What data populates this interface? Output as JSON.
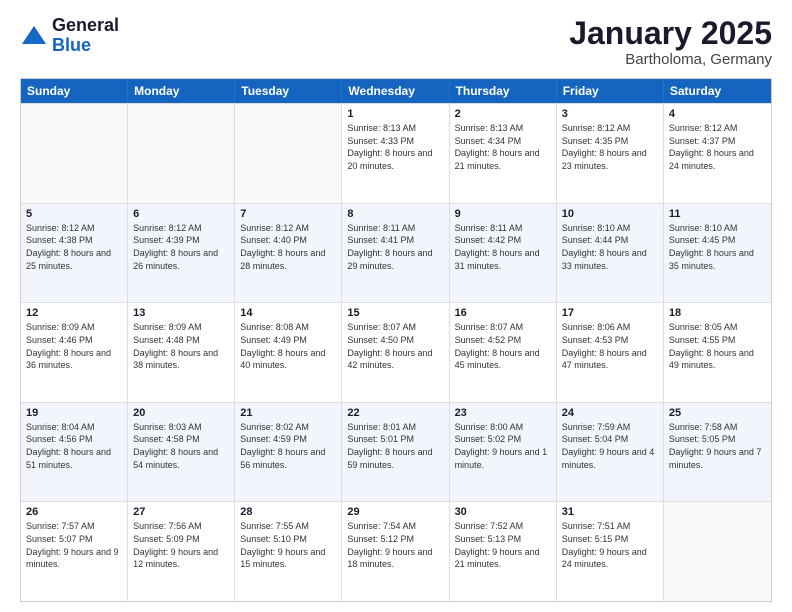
{
  "logo": {
    "general": "General",
    "blue": "Blue"
  },
  "header": {
    "month": "January 2025",
    "location": "Bartholoma, Germany"
  },
  "weekdays": [
    "Sunday",
    "Monday",
    "Tuesday",
    "Wednesday",
    "Thursday",
    "Friday",
    "Saturday"
  ],
  "weeks": [
    [
      {
        "day": "",
        "sunrise": "",
        "sunset": "",
        "daylight": ""
      },
      {
        "day": "",
        "sunrise": "",
        "sunset": "",
        "daylight": ""
      },
      {
        "day": "",
        "sunrise": "",
        "sunset": "",
        "daylight": ""
      },
      {
        "day": "1",
        "sunrise": "Sunrise: 8:13 AM",
        "sunset": "Sunset: 4:33 PM",
        "daylight": "Daylight: 8 hours and 20 minutes."
      },
      {
        "day": "2",
        "sunrise": "Sunrise: 8:13 AM",
        "sunset": "Sunset: 4:34 PM",
        "daylight": "Daylight: 8 hours and 21 minutes."
      },
      {
        "day": "3",
        "sunrise": "Sunrise: 8:12 AM",
        "sunset": "Sunset: 4:35 PM",
        "daylight": "Daylight: 8 hours and 23 minutes."
      },
      {
        "day": "4",
        "sunrise": "Sunrise: 8:12 AM",
        "sunset": "Sunset: 4:37 PM",
        "daylight": "Daylight: 8 hours and 24 minutes."
      }
    ],
    [
      {
        "day": "5",
        "sunrise": "Sunrise: 8:12 AM",
        "sunset": "Sunset: 4:38 PM",
        "daylight": "Daylight: 8 hours and 25 minutes."
      },
      {
        "day": "6",
        "sunrise": "Sunrise: 8:12 AM",
        "sunset": "Sunset: 4:39 PM",
        "daylight": "Daylight: 8 hours and 26 minutes."
      },
      {
        "day": "7",
        "sunrise": "Sunrise: 8:12 AM",
        "sunset": "Sunset: 4:40 PM",
        "daylight": "Daylight: 8 hours and 28 minutes."
      },
      {
        "day": "8",
        "sunrise": "Sunrise: 8:11 AM",
        "sunset": "Sunset: 4:41 PM",
        "daylight": "Daylight: 8 hours and 29 minutes."
      },
      {
        "day": "9",
        "sunrise": "Sunrise: 8:11 AM",
        "sunset": "Sunset: 4:42 PM",
        "daylight": "Daylight: 8 hours and 31 minutes."
      },
      {
        "day": "10",
        "sunrise": "Sunrise: 8:10 AM",
        "sunset": "Sunset: 4:44 PM",
        "daylight": "Daylight: 8 hours and 33 minutes."
      },
      {
        "day": "11",
        "sunrise": "Sunrise: 8:10 AM",
        "sunset": "Sunset: 4:45 PM",
        "daylight": "Daylight: 8 hours and 35 minutes."
      }
    ],
    [
      {
        "day": "12",
        "sunrise": "Sunrise: 8:09 AM",
        "sunset": "Sunset: 4:46 PM",
        "daylight": "Daylight: 8 hours and 36 minutes."
      },
      {
        "day": "13",
        "sunrise": "Sunrise: 8:09 AM",
        "sunset": "Sunset: 4:48 PM",
        "daylight": "Daylight: 8 hours and 38 minutes."
      },
      {
        "day": "14",
        "sunrise": "Sunrise: 8:08 AM",
        "sunset": "Sunset: 4:49 PM",
        "daylight": "Daylight: 8 hours and 40 minutes."
      },
      {
        "day": "15",
        "sunrise": "Sunrise: 8:07 AM",
        "sunset": "Sunset: 4:50 PM",
        "daylight": "Daylight: 8 hours and 42 minutes."
      },
      {
        "day": "16",
        "sunrise": "Sunrise: 8:07 AM",
        "sunset": "Sunset: 4:52 PM",
        "daylight": "Daylight: 8 hours and 45 minutes."
      },
      {
        "day": "17",
        "sunrise": "Sunrise: 8:06 AM",
        "sunset": "Sunset: 4:53 PM",
        "daylight": "Daylight: 8 hours and 47 minutes."
      },
      {
        "day": "18",
        "sunrise": "Sunrise: 8:05 AM",
        "sunset": "Sunset: 4:55 PM",
        "daylight": "Daylight: 8 hours and 49 minutes."
      }
    ],
    [
      {
        "day": "19",
        "sunrise": "Sunrise: 8:04 AM",
        "sunset": "Sunset: 4:56 PM",
        "daylight": "Daylight: 8 hours and 51 minutes."
      },
      {
        "day": "20",
        "sunrise": "Sunrise: 8:03 AM",
        "sunset": "Sunset: 4:58 PM",
        "daylight": "Daylight: 8 hours and 54 minutes."
      },
      {
        "day": "21",
        "sunrise": "Sunrise: 8:02 AM",
        "sunset": "Sunset: 4:59 PM",
        "daylight": "Daylight: 8 hours and 56 minutes."
      },
      {
        "day": "22",
        "sunrise": "Sunrise: 8:01 AM",
        "sunset": "Sunset: 5:01 PM",
        "daylight": "Daylight: 8 hours and 59 minutes."
      },
      {
        "day": "23",
        "sunrise": "Sunrise: 8:00 AM",
        "sunset": "Sunset: 5:02 PM",
        "daylight": "Daylight: 9 hours and 1 minute."
      },
      {
        "day": "24",
        "sunrise": "Sunrise: 7:59 AM",
        "sunset": "Sunset: 5:04 PM",
        "daylight": "Daylight: 9 hours and 4 minutes."
      },
      {
        "day": "25",
        "sunrise": "Sunrise: 7:58 AM",
        "sunset": "Sunset: 5:05 PM",
        "daylight": "Daylight: 9 hours and 7 minutes."
      }
    ],
    [
      {
        "day": "26",
        "sunrise": "Sunrise: 7:57 AM",
        "sunset": "Sunset: 5:07 PM",
        "daylight": "Daylight: 9 hours and 9 minutes."
      },
      {
        "day": "27",
        "sunrise": "Sunrise: 7:56 AM",
        "sunset": "Sunset: 5:09 PM",
        "daylight": "Daylight: 9 hours and 12 minutes."
      },
      {
        "day": "28",
        "sunrise": "Sunrise: 7:55 AM",
        "sunset": "Sunset: 5:10 PM",
        "daylight": "Daylight: 9 hours and 15 minutes."
      },
      {
        "day": "29",
        "sunrise": "Sunrise: 7:54 AM",
        "sunset": "Sunset: 5:12 PM",
        "daylight": "Daylight: 9 hours and 18 minutes."
      },
      {
        "day": "30",
        "sunrise": "Sunrise: 7:52 AM",
        "sunset": "Sunset: 5:13 PM",
        "daylight": "Daylight: 9 hours and 21 minutes."
      },
      {
        "day": "31",
        "sunrise": "Sunrise: 7:51 AM",
        "sunset": "Sunset: 5:15 PM",
        "daylight": "Daylight: 9 hours and 24 minutes."
      },
      {
        "day": "",
        "sunrise": "",
        "sunset": "",
        "daylight": ""
      }
    ]
  ]
}
